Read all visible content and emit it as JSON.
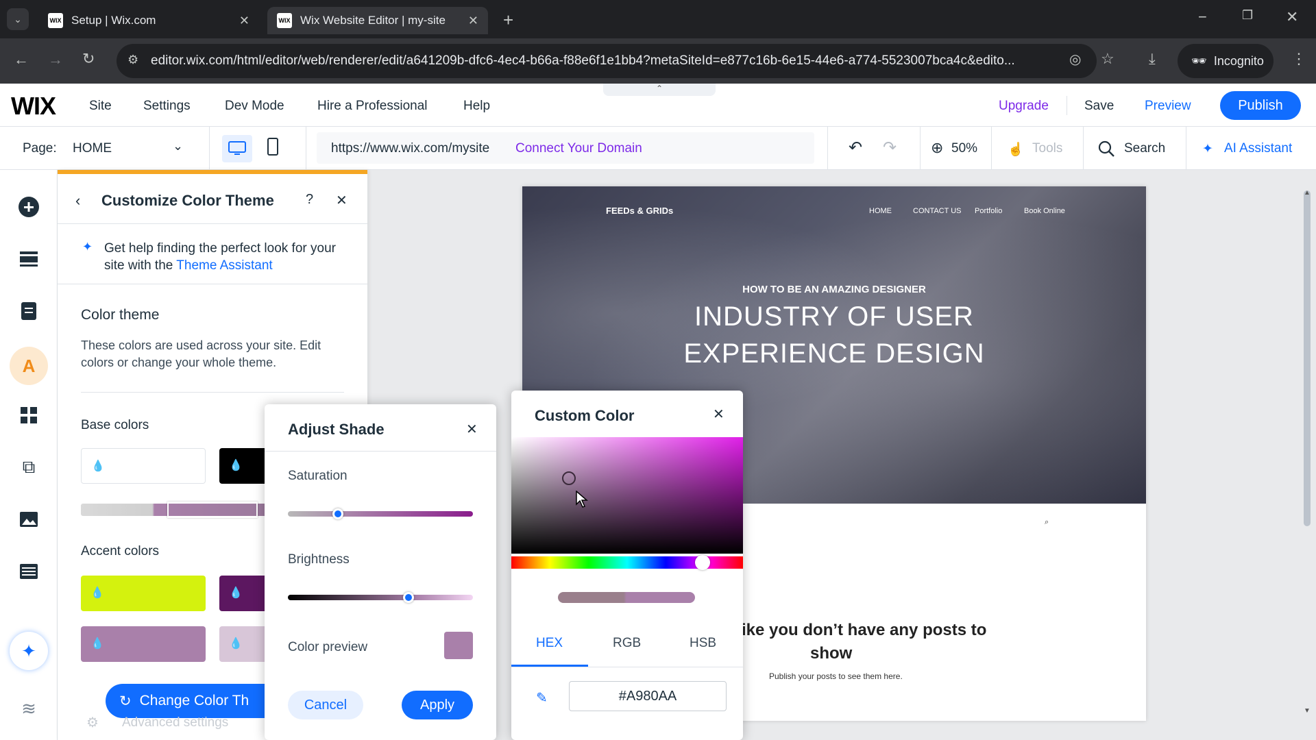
{
  "browser": {
    "tabs": [
      {
        "label": "Setup | Wix.com",
        "favicon": "WIX"
      },
      {
        "label": "Wix Website Editor | my-site",
        "favicon": "WIX"
      }
    ],
    "url": "editor.wix.com/html/editor/web/renderer/edit/a641209b-dfc6-4ec4-b66a-f88e6f1e1bb4?metaSiteId=e877c16b-6e15-44e6-a774-5523007bca4c&edito...",
    "incognito_label": "Incognito"
  },
  "topbar": {
    "logo": "WIX",
    "menu": [
      "Site",
      "Settings",
      "Dev Mode",
      "Hire a Professional",
      "Help"
    ],
    "upgrade": "Upgrade",
    "save": "Save",
    "preview": "Preview",
    "publish": "Publish"
  },
  "secondbar": {
    "page_label": "Page:",
    "page_value": "HOME",
    "site_url": "https://www.wix.com/mysite",
    "connect_domain": "Connect Your Domain",
    "zoom": "50%",
    "tools": "Tools",
    "search": "Search",
    "ai": "AI Assistant"
  },
  "panel": {
    "title": "Customize Color Theme",
    "help_q": "?",
    "help_text": "Get help finding the perfect look for your site with the",
    "help_link": "Theme Assistant",
    "section_title": "Color theme",
    "section_desc": "These colors are used across your site. Edit colors or change your whole theme.",
    "base_colors": "Base colors",
    "accent_colors": "Accent colors",
    "change_button": "Change Color Th",
    "advanced": "Advanced settings"
  },
  "adjust_shade": {
    "title": "Adjust Shade",
    "saturation": "Saturation",
    "saturation_value": 0.27,
    "brightness": "Brightness",
    "brightness_value": 0.65,
    "color_preview": "Color preview",
    "cancel": "Cancel",
    "apply": "Apply"
  },
  "custom_color": {
    "title": "Custom Color",
    "tabs": [
      "HEX",
      "RGB",
      "HSB"
    ],
    "active_tab": "HEX",
    "hex_value": "#A980AA"
  },
  "site": {
    "logo": "FEEDs & GRIDs",
    "nav": [
      "HOME",
      "CONTACT US",
      "Portfolio",
      "Book Online"
    ],
    "kicker": "HOW TO BE AN AMAZING DESIGNER",
    "headline_1": "INDUSTRY OF USER",
    "headline_2": "EXPERIENCE DESIGN",
    "empty_title_1": "ike you don’t have any posts to",
    "empty_title_2": "show",
    "empty_sub": "Publish your posts to see them here."
  },
  "colors": {
    "accent_blue": "#116dff",
    "selected_color": "#A980AA",
    "accent_lime": "#d4f20e",
    "accent_purple": "#5c1760",
    "accent_lilac": "#a980aa",
    "accent_light": "#d8c6d8"
  }
}
